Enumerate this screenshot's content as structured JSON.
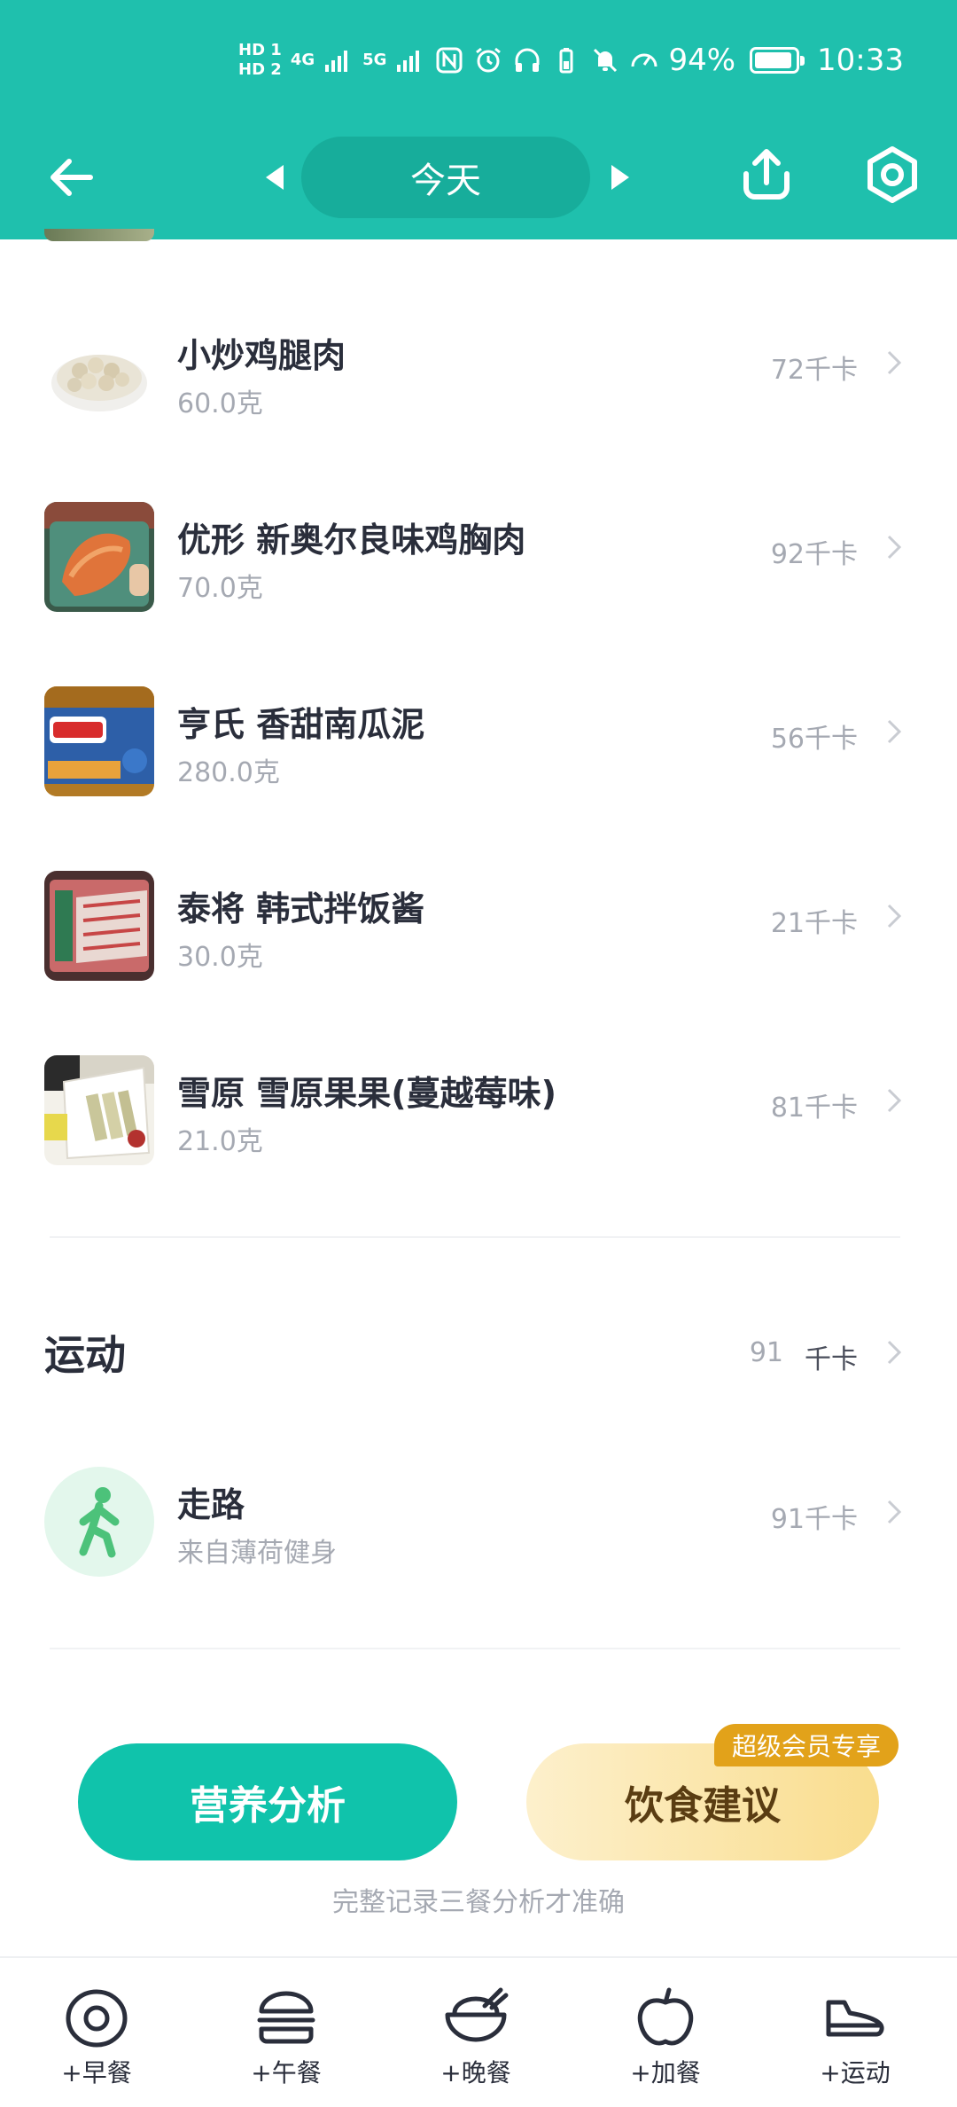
{
  "status_bar": {
    "network_1": "HD 1",
    "network_2": "HD 2",
    "sim1_type": "4G",
    "sim2_type": "5G",
    "battery_percent": "94%",
    "battery_level": 0.94,
    "time": "10:33"
  },
  "header": {
    "date_label": "今天",
    "bg_color": "#1fc0ad"
  },
  "food_items": [
    {
      "name": "小炒鸡腿肉",
      "amount": "60.0克",
      "kcal": "72千卡"
    },
    {
      "name": "优形 新奥尔良味鸡胸肉",
      "amount": "70.0克",
      "kcal": "92千卡"
    },
    {
      "name": "亨氏 香甜南瓜泥",
      "amount": "280.0克",
      "kcal": "56千卡"
    },
    {
      "name": "泰将 韩式拌饭酱",
      "amount": "30.0克",
      "kcal": "21千卡"
    },
    {
      "name": "雪原 雪原果果(蔓越莓味)",
      "amount": "21.0克",
      "kcal": "81千卡"
    }
  ],
  "exercise": {
    "title": "运动",
    "total_value": "91",
    "total_unit": "千卡",
    "items": [
      {
        "name": "走路",
        "source": "来自薄荷健身",
        "kcal": "91千卡"
      }
    ]
  },
  "actions": {
    "analysis_label": "营养分析",
    "advice_label": "饮食建议",
    "vip_badge": "超级会员专享",
    "hint": "完整记录三餐分析才准确"
  },
  "bottom_tabs": [
    {
      "label": "+早餐",
      "icon": "egg-icon"
    },
    {
      "label": "+午餐",
      "icon": "burger-icon"
    },
    {
      "label": "+晚餐",
      "icon": "bowl-icon"
    },
    {
      "label": "+加餐",
      "icon": "apple-icon"
    },
    {
      "label": "+运动",
      "icon": "shoe-icon"
    }
  ],
  "colors": {
    "primary": "#1fc0ad",
    "analysis_button": "#10c3ab",
    "vip": "#e2a21a",
    "muted_text": "#a5a9b2",
    "main_text": "#2a2e3b"
  }
}
